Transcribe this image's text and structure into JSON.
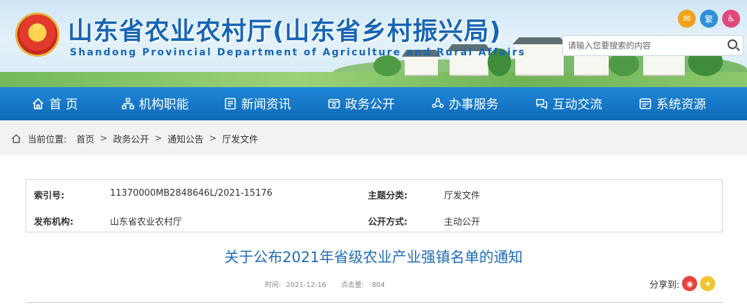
{
  "site": {
    "title": "山东省农业农村厅(山东省乡村振兴局)",
    "subtitle": "Shandong Provincial Department of Agriculture and Rural Affairs"
  },
  "top_icons": [
    {
      "name": "mail-icon",
      "glyph": "✉",
      "color": "#f2a31b"
    },
    {
      "name": "traditional-chinese-toggle",
      "glyph": "繁",
      "color": "#2f8fd6"
    },
    {
      "name": "accessibility-icon",
      "glyph": "♿",
      "color": "#e04a7a"
    }
  ],
  "search": {
    "placeholder": "请输入您要搜索的内容"
  },
  "nav": [
    {
      "label": "首 页",
      "icon": "home-icon"
    },
    {
      "label": "机构职能",
      "icon": "org-chart-icon"
    },
    {
      "label": "新闻资讯",
      "icon": "news-icon"
    },
    {
      "label": "政务公开",
      "icon": "open-affairs-icon"
    },
    {
      "label": "办事服务",
      "icon": "service-icon"
    },
    {
      "label": "互动交流",
      "icon": "chat-icon"
    },
    {
      "label": "系统资源",
      "icon": "resources-icon"
    }
  ],
  "breadcrumb": {
    "prefix": "当前位置:",
    "items": [
      "首页",
      "政务公开",
      "通知公告",
      "厅发文件"
    ],
    "separator": ">"
  },
  "meta": {
    "index_label": "索引号:",
    "index_value": "11370000MB2848646L/2021-15176",
    "topic_label": "主题分类:",
    "topic_value": "厅发文件",
    "publisher_label": "发布机构:",
    "publisher_value": "山东省农业农村厅",
    "method_label": "公开方式:",
    "method_value": "主动公开"
  },
  "article": {
    "title": "关于公布2021年省级农业产业强镇名单的通知",
    "time_label": "时间:",
    "time_value": "2021-12-16",
    "clicks_label": "点击量:",
    "clicks_value": "804"
  },
  "share": {
    "label": "分享到:"
  },
  "colors": {
    "brand_blue": "#1766b5",
    "nav_blue": "#1478c8",
    "title_blue": "#1f6db8"
  }
}
